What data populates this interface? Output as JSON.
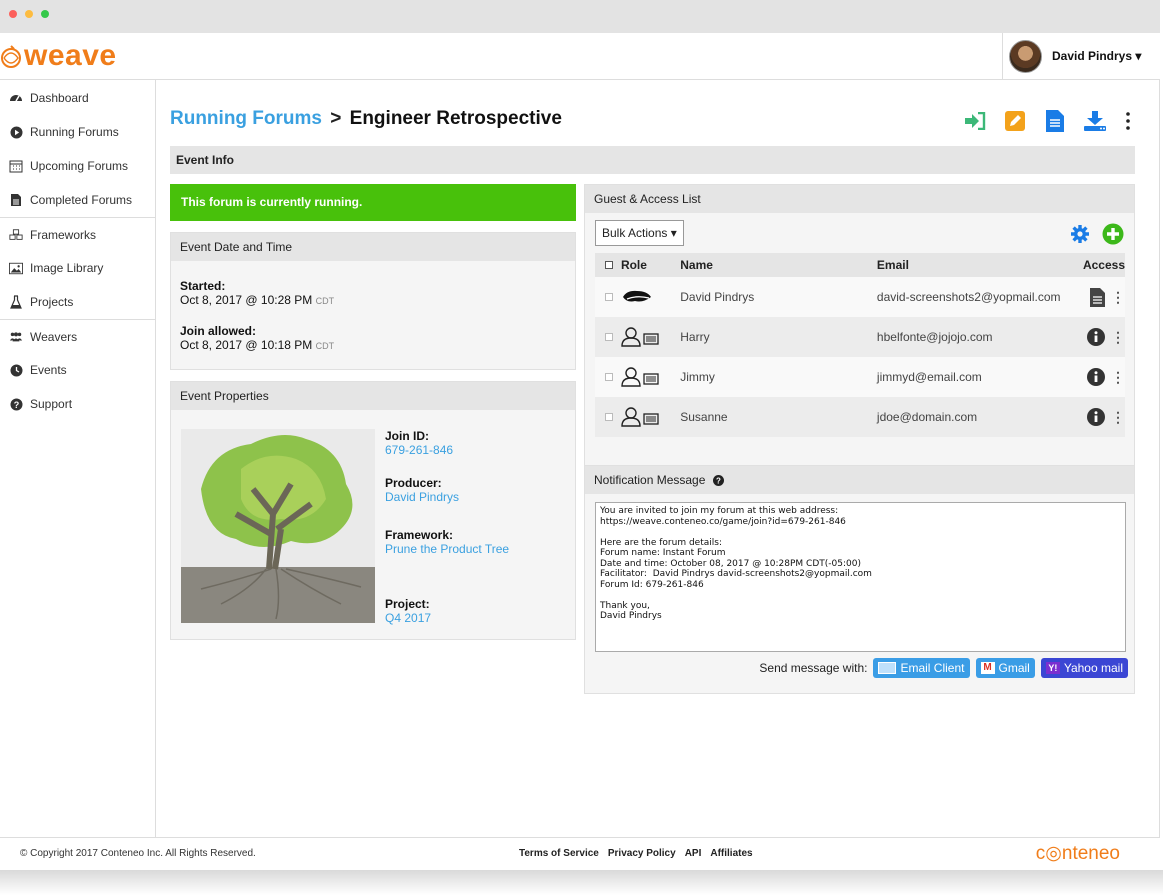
{
  "app": {
    "logo_text": "weave",
    "user_name": "David Pindrys ▾"
  },
  "sidebar": {
    "items": [
      {
        "label": "Dashboard",
        "icon": "dashboard-icon"
      },
      {
        "label": "Running Forums",
        "icon": "play-circle-icon"
      },
      {
        "label": "Upcoming Forums",
        "icon": "calendar-icon"
      },
      {
        "label": "Completed Forums",
        "icon": "document-icon"
      },
      {
        "label": "Frameworks",
        "icon": "cubes-icon"
      },
      {
        "label": "Image Library",
        "icon": "image-icon"
      },
      {
        "label": "Projects",
        "icon": "flask-icon"
      },
      {
        "label": "Weavers",
        "icon": "users-icon"
      },
      {
        "label": "Events",
        "icon": "clock-icon"
      },
      {
        "label": "Support",
        "icon": "question-circle-icon"
      }
    ]
  },
  "breadcrumb": {
    "parent": "Running Forums",
    "separator": ">",
    "current": "Engineer Retrospective"
  },
  "toolbar": {
    "icons": [
      "join-icon",
      "edit-icon",
      "report-icon",
      "download-icon",
      "more-icon"
    ],
    "colors": {
      "join": "#3cb878",
      "edit": "#f3a21b",
      "report": "#1a7ce6",
      "download": "#1a7ce6"
    }
  },
  "event_info": {
    "title": "Event Info",
    "status_banner": "This forum is currently running.",
    "date_panel": {
      "title": "Event Date and Time",
      "started_label": "Started:",
      "started_value": "Oct 8, 2017 @ 10:28 PM",
      "started_tz": "CDT",
      "join_label": "Join allowed:",
      "join_value": "Oct 8, 2017 @ 10:18 PM",
      "join_tz": "CDT"
    },
    "properties_panel": {
      "title": "Event Properties",
      "join_id_label": "Join ID:",
      "join_id_value": "679-261-846",
      "producer_label": "Producer:",
      "producer_value": "David Pindrys",
      "framework_label": "Framework:",
      "framework_value": "Prune the Product Tree",
      "project_label": "Project:",
      "project_value": "Q4 2017"
    }
  },
  "guest_list": {
    "title": "Guest & Access List",
    "bulk_actions": "Bulk Actions ▾",
    "columns": {
      "role": "Role",
      "name": "Name",
      "email": "Email",
      "access": "Access"
    },
    "rows": [
      {
        "role": "producer-hat-icon",
        "name": "David Pindrys",
        "email": "david-screenshots2@yopmail.com",
        "access": "document-icon"
      },
      {
        "role": "participant-icon",
        "name": "Harry",
        "email": "hbelfonte@jojojo.com",
        "access": "info-icon"
      },
      {
        "role": "participant-icon",
        "name": "Jimmy",
        "email": "jimmyd@email.com",
        "access": "info-icon"
      },
      {
        "role": "participant-icon",
        "name": "Susanne",
        "email": "jdoe@domain.com",
        "access": "info-icon"
      }
    ]
  },
  "notification": {
    "title": "Notification Message",
    "message": "You are invited to join my forum at this web address:\nhttps://weave.conteneo.co/game/join?id=679-261-846\n\nHere are the forum details:\nForum name: Instant Forum\nDate and time: October 08, 2017 @ 10:28PM CDT(-05:00)\nFacilitator:  David Pindrys david-screenshots2@yopmail.com\nForum Id: 679-261-846\n\nThank you,\nDavid Pindrys",
    "send_label": "Send message with:",
    "email_client": "Email Client",
    "gmail": "Gmail",
    "yahoo": "Yahoo mail"
  },
  "footer": {
    "copyright": "© Copyright 2017 Conteneo Inc. All Rights Reserved.",
    "links": [
      "Terms of Service",
      "Privacy Policy",
      "API",
      "Affiliates"
    ],
    "brand": "c◎nteneo"
  }
}
